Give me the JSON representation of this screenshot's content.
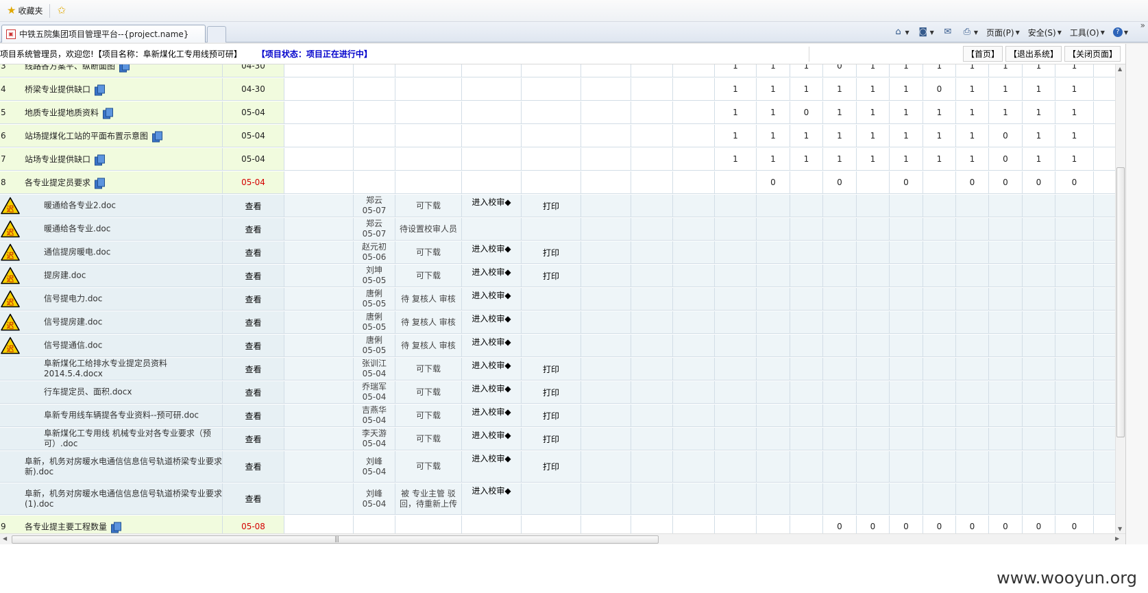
{
  "browser": {
    "favorites_label": "收藏夹",
    "tab_title": "中铁五院集团项目管理平台--{project.name}",
    "cmd": {
      "page": "页面(P)",
      "safety": "安全(S)",
      "tools": "工具(O)"
    }
  },
  "header": {
    "welcome": "项目系统管理员，欢迎您!【项目名称：阜新煤化工专用线预可研】",
    "status": "【项目状态：项目正在进行中】",
    "links": [
      "【首页】",
      "【退出系统】",
      "【关闭页面】"
    ]
  },
  "labels": {
    "view": "查看",
    "enter_review": "进入校审◆",
    "print": "打印"
  },
  "rows": [
    {
      "type": "task",
      "num": "3",
      "title": "线路各方案平、纵断面图",
      "date": "04-30",
      "date_color": "normal",
      "cells": [
        "1",
        "1",
        "1",
        "0",
        "1",
        "1",
        "1",
        "1",
        "1",
        "1",
        "1"
      ]
    },
    {
      "type": "task",
      "num": "4",
      "title": "桥梁专业提供缺口",
      "date": "04-30",
      "date_color": "normal",
      "cells": [
        "1",
        "1",
        "1",
        "1",
        "1",
        "1",
        "0",
        "1",
        "1",
        "1",
        "1"
      ]
    },
    {
      "type": "task",
      "num": "5",
      "title": "地质专业提地质资料",
      "date": "05-04",
      "date_color": "normal",
      "cells": [
        "1",
        "1",
        "0",
        "1",
        "1",
        "1",
        "1",
        "1",
        "1",
        "1",
        "1"
      ]
    },
    {
      "type": "task",
      "num": "6",
      "title": "站场提煤化工站的平面布置示意图",
      "date": "05-04",
      "date_color": "normal",
      "cells": [
        "1",
        "1",
        "1",
        "1",
        "1",
        "1",
        "1",
        "1",
        "0",
        "1",
        "1"
      ]
    },
    {
      "type": "task",
      "num": "7",
      "title": "站场专业提供缺口",
      "date": "05-04",
      "date_color": "normal",
      "cells": [
        "1",
        "1",
        "1",
        "1",
        "1",
        "1",
        "1",
        "1",
        "0",
        "1",
        "1"
      ]
    },
    {
      "type": "task",
      "num": "8",
      "title": "各专业提定员要求",
      "date": "05-04",
      "date_color": "red",
      "cells": [
        "",
        "0",
        "",
        "0",
        "",
        "0",
        "",
        "0",
        "0",
        "0",
        "0"
      ]
    },
    {
      "type": "doc",
      "late": true,
      "title": "暖通给各专业2.doc",
      "person": "郑云",
      "pdate": "05-07",
      "state": "可下载",
      "enter": true,
      "print": true
    },
    {
      "type": "doc",
      "late": true,
      "title": "暖通给各专业.doc",
      "person": "郑云",
      "pdate": "05-07",
      "state": "待设置校审人员",
      "enter": false,
      "print": false
    },
    {
      "type": "doc",
      "late": true,
      "title": "通信提房暖电.doc",
      "person": "赵元初",
      "pdate": "05-06",
      "state": "可下载",
      "enter": true,
      "print": true
    },
    {
      "type": "doc",
      "late": true,
      "title": "提房建.doc",
      "person": "刘坤",
      "pdate": "05-05",
      "state": "可下载",
      "enter": true,
      "print": true
    },
    {
      "type": "doc",
      "late": true,
      "title": "信号提电力.doc",
      "person": "唐俐",
      "pdate": "05-05",
      "state": "待 复核人 审核",
      "enter": true,
      "print": false
    },
    {
      "type": "doc",
      "late": true,
      "title": "信号提房建.doc",
      "person": "唐俐",
      "pdate": "05-05",
      "state": "待 复核人 审核",
      "enter": true,
      "print": false
    },
    {
      "type": "doc",
      "late": true,
      "title": "信号提通信.doc",
      "person": "唐俐",
      "pdate": "05-05",
      "state": "待 复核人 审核",
      "enter": true,
      "print": false
    },
    {
      "type": "doc",
      "late": false,
      "title": "阜新煤化工给排水专业提定员资料2014.5.4.docx",
      "person": "张训江",
      "pdate": "05-04",
      "state": "可下载",
      "enter": true,
      "print": true
    },
    {
      "type": "doc",
      "late": false,
      "title": "行车提定员、面积.docx",
      "person": "乔瑞军",
      "pdate": "05-04",
      "state": "可下载",
      "enter": true,
      "print": true
    },
    {
      "type": "doc",
      "late": false,
      "title": "阜新专用线车辆提各专业资料--预可研.doc",
      "person": "吉燕华",
      "pdate": "05-04",
      "state": "可下载",
      "enter": true,
      "print": true
    },
    {
      "type": "doc",
      "late": false,
      "title": "阜新煤化工专用线 机械专业对各专业要求（预可）.doc",
      "person": "李天游",
      "pdate": "05-04",
      "state": "可下载",
      "enter": true,
      "print": true
    },
    {
      "type": "doc",
      "late": false,
      "title": "阜新，机务对房暖水电通信信息信号轨道桥梁专业要求(最新).doc",
      "person": "刘峰",
      "pdate": "05-04",
      "state": "可下载",
      "enter": true,
      "print": true
    },
    {
      "type": "doc",
      "late": false,
      "title": "阜新，机务对房暖水电通信信息信号轨道桥梁专业要求(1).doc",
      "person": "刘峰",
      "pdate": "05-04",
      "state": "被 专业主管 驳回，待重新上传",
      "enter": true,
      "print": false
    },
    {
      "type": "task",
      "num": "9",
      "title": "各专业提主要工程数量",
      "date": "05-08",
      "date_color": "red",
      "cells": [
        "",
        "",
        "",
        "0",
        "0",
        "0",
        "0",
        "0",
        "0",
        "0",
        "0"
      ]
    }
  ],
  "watermark": "www.wooyun.org"
}
